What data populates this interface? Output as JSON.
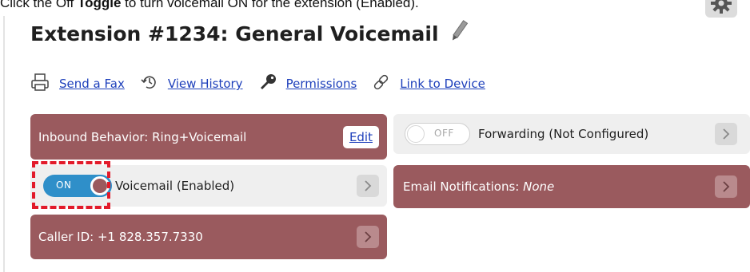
{
  "instruction": {
    "prefix": "Click the Off ",
    "bold": "Toggle",
    "suffix": " to turn voicemail ON for the extension (Enabled)."
  },
  "header": {
    "title": "Extension #1234: General Voicemail",
    "edit_icon": "pencil-icon",
    "settings_icon": "gear-icon"
  },
  "actions": [
    {
      "label": "Send a Fax",
      "icon": "fax-icon"
    },
    {
      "label": "View History",
      "icon": "history-icon"
    },
    {
      "label": "Permissions",
      "icon": "key-icon"
    },
    {
      "label": "Link to Device",
      "icon": "link-icon"
    }
  ],
  "cards": {
    "inbound": {
      "label": "Inbound Behavior: Ring+Voicemail",
      "button": "Edit"
    },
    "forwarding": {
      "toggle": "OFF",
      "label": "Forwarding (Not Configured)"
    },
    "voicemail": {
      "toggle": "ON",
      "label": "Voicemail (Enabled)"
    },
    "email": {
      "label_prefix": "Email Notifications: ",
      "label_value": "None"
    },
    "caller_id": {
      "label": "Caller ID: +1 828.357.7330"
    }
  },
  "colors": {
    "accent_red": "#9a5a5e",
    "link_blue": "#1d3fbb",
    "toggle_on": "#2f8fc9",
    "highlight": "#e21a2a"
  }
}
